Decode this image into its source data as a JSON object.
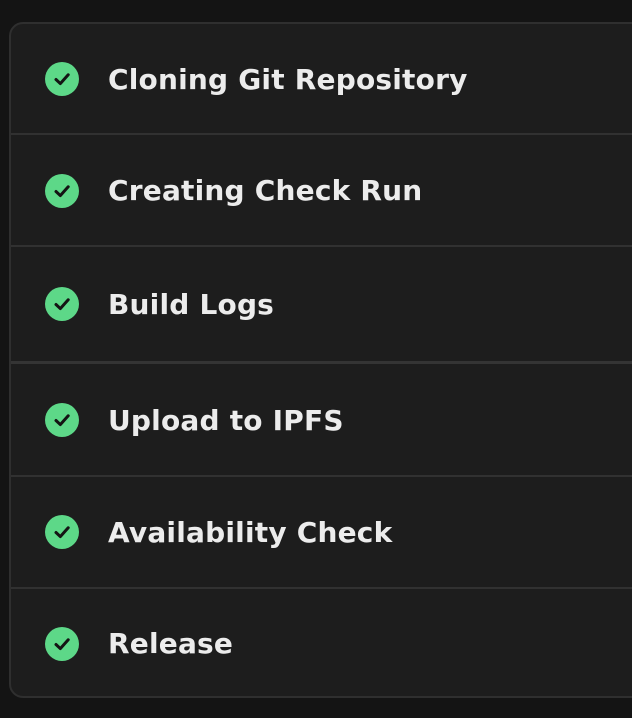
{
  "steps": [
    {
      "label": "Cloning Git Repository",
      "status_icon": "check-circle-icon",
      "status": "success"
    },
    {
      "label": "Creating Check Run",
      "status_icon": "check-circle-icon",
      "status": "success"
    },
    {
      "label": "Build Logs",
      "status_icon": "check-circle-icon",
      "status": "success"
    },
    {
      "label": "Upload to IPFS",
      "status_icon": "check-circle-icon",
      "status": "success"
    },
    {
      "label": "Availability Check",
      "status_icon": "check-circle-icon",
      "status": "success"
    },
    {
      "label": "Release",
      "status_icon": "check-circle-icon",
      "status": "success"
    }
  ],
  "colors": {
    "background": "#141414",
    "panel": "#1d1d1d",
    "border": "#2f2f2f",
    "success": "#5dd888",
    "text": "#ececec"
  }
}
